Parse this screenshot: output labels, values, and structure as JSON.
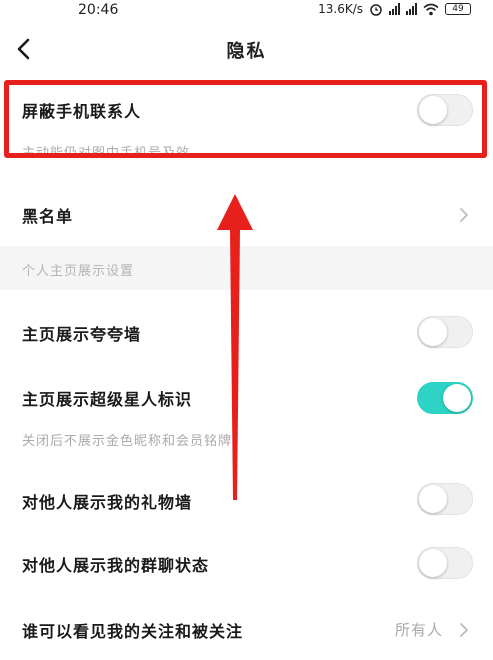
{
  "status_bar": {
    "time": "20:46",
    "net_speed": "13.6K/s",
    "battery": "49"
  },
  "header": {
    "title": "隐私"
  },
  "block_contacts": {
    "label": "屏蔽手机联系人",
    "desc": "主动能仍对图中手机号及效",
    "enabled": false
  },
  "blacklist": {
    "label": "黑名单"
  },
  "section": {
    "title": "个人主页展示设置"
  },
  "show_praise_wall": {
    "label": "主页展示夸夸墙",
    "enabled": false
  },
  "show_superstar_badge": {
    "label": "主页展示超级星人标识",
    "desc": "关闭后不展示金色昵称和会员铭牌",
    "enabled": true
  },
  "show_gift_wall": {
    "label": "对他人展示我的礼物墙",
    "enabled": false
  },
  "show_group_status": {
    "label": "对他人展示我的群聊状态",
    "enabled": false
  },
  "follow_visibility": {
    "label": "谁可以看见我的关注和被关注",
    "value": "所有人"
  },
  "colors": {
    "accent": "#2dd3c4",
    "annotation": "#e8201c"
  }
}
